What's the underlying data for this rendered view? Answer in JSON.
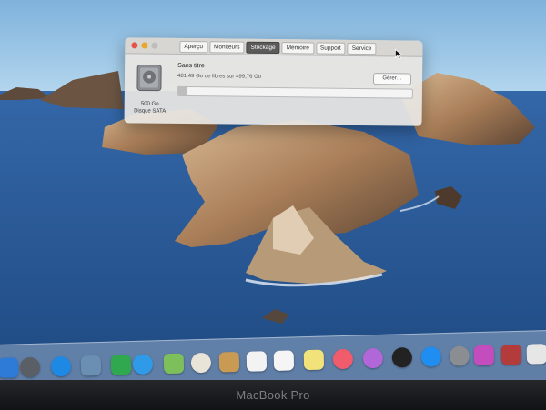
{
  "window": {
    "tabs": [
      {
        "label": "Aperçu",
        "active": false
      },
      {
        "label": "Moniteurs",
        "active": false
      },
      {
        "label": "Stockage",
        "active": true
      },
      {
        "label": "Mémoire",
        "active": false
      },
      {
        "label": "Support",
        "active": false
      },
      {
        "label": "Service",
        "active": false
      }
    ],
    "disk": {
      "size_label": "500 Go",
      "type_label": "Disque SATA",
      "volume_name": "Sans titre",
      "free_text": "481,49 Go de libres sur 499,76 Go",
      "used_fraction": 0.037
    },
    "manage_button": "Gérer…"
  },
  "dock": {
    "icons": [
      "finder-icon",
      "launchpad-icon",
      "safari-icon",
      "preview-icon",
      "facetime-icon",
      "messages-icon",
      "maps-icon",
      "photos-icon",
      "contacts-icon",
      "calendar-icon",
      "reminders-icon",
      "notes-icon",
      "music-icon",
      "podcasts-icon",
      "tv-icon",
      "app-store-icon",
      "system-preferences-icon",
      "itunes-store-icon",
      "photo-booth-icon",
      "document-icon"
    ]
  },
  "laptop": {
    "brand": "MacBook Pro"
  },
  "colors": {
    "sea": "#2f5e9c",
    "sky": "#8cc1e4",
    "rock": "#b48a63",
    "active_tab": "#5b5b5b"
  }
}
